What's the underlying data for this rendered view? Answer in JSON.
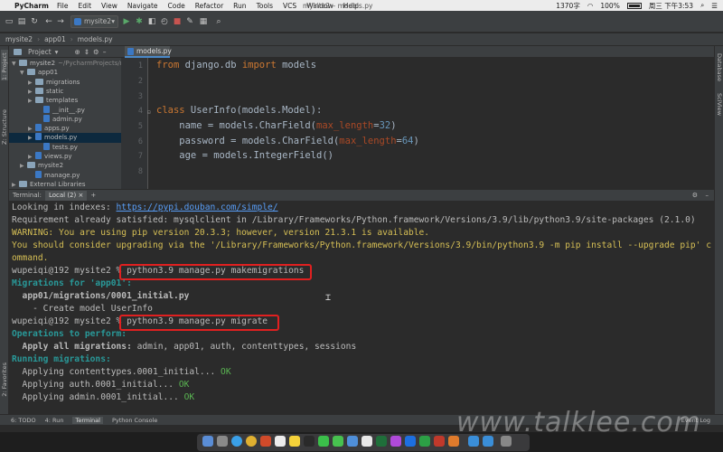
{
  "menubar": {
    "app": "PyCharm",
    "items": [
      "File",
      "Edit",
      "View",
      "Navigate",
      "Code",
      "Refactor",
      "Run",
      "Tools",
      "VCS",
      "Window",
      "Help"
    ],
    "title": "mysite2 – models.py",
    "status_count": "1370字",
    "battery": "100%",
    "clock": "周三 下午3:53"
  },
  "toolbar": {
    "run_config": "mysite2"
  },
  "breadcrumb": [
    "mysite2",
    "app01",
    "models.py"
  ],
  "project": {
    "header_label": "Project",
    "side_label": "1: Project",
    "tree": [
      {
        "label": "mysite2",
        "extra": "~/PycharmProjects/m",
        "indent": 0,
        "type": "folder",
        "open": true
      },
      {
        "label": "app01",
        "indent": 1,
        "type": "folder",
        "open": true
      },
      {
        "label": "migrations",
        "indent": 2,
        "type": "folder",
        "open": false
      },
      {
        "label": "static",
        "indent": 2,
        "type": "folder",
        "open": false
      },
      {
        "label": "templates",
        "indent": 2,
        "type": "folder",
        "open": false
      },
      {
        "label": "__init__.py",
        "indent": 3,
        "type": "py"
      },
      {
        "label": "admin.py",
        "indent": 3,
        "type": "py"
      },
      {
        "label": "apps.py",
        "indent": 2,
        "type": "py",
        "open": false
      },
      {
        "label": "models.py",
        "indent": 2,
        "type": "py",
        "open": false,
        "selected": true
      },
      {
        "label": "tests.py",
        "indent": 3,
        "type": "py"
      },
      {
        "label": "views.py",
        "indent": 2,
        "type": "py",
        "open": false
      },
      {
        "label": "mysite2",
        "indent": 1,
        "type": "folder",
        "open": false
      },
      {
        "label": "manage.py",
        "indent": 2,
        "type": "py"
      },
      {
        "label": "External Libraries",
        "indent": 0,
        "type": "folder",
        "open": false
      }
    ]
  },
  "side_labels": {
    "structure": "Z: Structure",
    "favorites": "2: Favorites",
    "database": "Database",
    "sciview": "SciView"
  },
  "editor": {
    "tab_label": "models.py",
    "line_numbers": [
      "1",
      "2",
      "3",
      "4",
      "5",
      "6",
      "7",
      "8"
    ],
    "code": {
      "l1_kw1": "from",
      "l1_mod": " django.db ",
      "l1_kw2": "import",
      "l1_rest": " models",
      "l4_kw": "class",
      "l4_rest": " UserInfo(models.Model):",
      "l5_a": "    name = models.CharField(",
      "l5_p": "max_length",
      "l5_eq": "=",
      "l5_n": "32",
      "l5_c": ")",
      "l6_a": "    password = models.CharField(",
      "l6_p": "max_length",
      "l6_eq": "=",
      "l6_n": "64",
      "l6_c": ")",
      "l7": "    age = models.IntegerField()"
    }
  },
  "terminal": {
    "header_label": "Terminal:",
    "tab_label": "Local (2)",
    "lines": {
      "idx_prefix": "Looking in indexes: ",
      "idx_url": "https://pypi.douban.com/simple/",
      "req": "Requirement already satisfied: mysqlclient in /Library/Frameworks/Python.framework/Versions/3.9/lib/python3.9/site-packages (2.1.0)",
      "warn": "WARNING: You are using pip version 20.3.3; however, version 21.3.1 is available.",
      "upgrade": "You should consider upgrading via the '/Library/Frameworks/Python.framework/Versions/3.9/bin/python3.9 -m pip install --upgrade pip' c",
      "upgrade2": "ommand.",
      "prompt": "wupeiqi@192 mysite2 % ",
      "cmd1": "python3.9 manage.py makemigrations",
      "mig_for": "Migrations for 'app01':",
      "mig_file": "  app01/migrations/0001_initial.py",
      "create": "    - Create model UserInfo",
      "cmd2": "python3.9 manage.py migrate",
      "ops": "Operations to perform:",
      "apply_label": "  Apply all migrations:",
      "apply_list": " admin, app01, auth, contenttypes, sessions",
      "running": "Running migrations:",
      "m1": "  Applying contenttypes.0001_initial... ",
      "m2": "  Applying auth.0001_initial... ",
      "m3": "  Applying admin.0001_initial... ",
      "ok": "OK"
    }
  },
  "bottombar": {
    "todo": "6: TODO",
    "run": "4: Run",
    "terminal": "Terminal",
    "console": "Python Console",
    "event_log": "Event Log"
  },
  "watermark": "www.talklee.com",
  "colors": {
    "accent": "#4a88c7",
    "highlight_box": "#e02020",
    "editor_bg": "#2b2b2b",
    "panel_bg": "#3c3f41"
  }
}
